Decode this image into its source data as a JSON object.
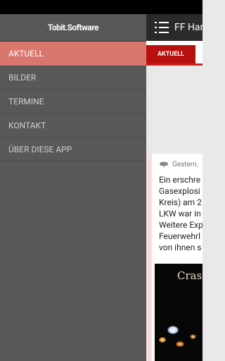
{
  "drawer": {
    "brand": "Tobit.Software",
    "items": [
      {
        "label": "AKTUELL",
        "active": true
      },
      {
        "label": "BILDER",
        "active": false
      },
      {
        "label": "TERMINE",
        "active": false
      },
      {
        "label": "KONTAKT",
        "active": false
      },
      {
        "label": "ÜBER DIESE APP",
        "active": false
      }
    ]
  },
  "app": {
    "title": "FF Han",
    "tabs": [
      {
        "label": "AKTUELL"
      }
    ]
  },
  "article": {
    "time": "Gestern,",
    "lines": [
      "Ein erschre",
      "Gasexplosi",
      "Kreis) am 2",
      "LKW war in",
      "Weitere Exp",
      "Feuerwehrl",
      "von ihnen s"
    ],
    "photo_caption": "Crash"
  },
  "colors": {
    "drawer_bg": "#585858",
    "active_item": "#d9776f",
    "accent_red": "#b6110f",
    "actionbar": "#2a2a2a"
  }
}
